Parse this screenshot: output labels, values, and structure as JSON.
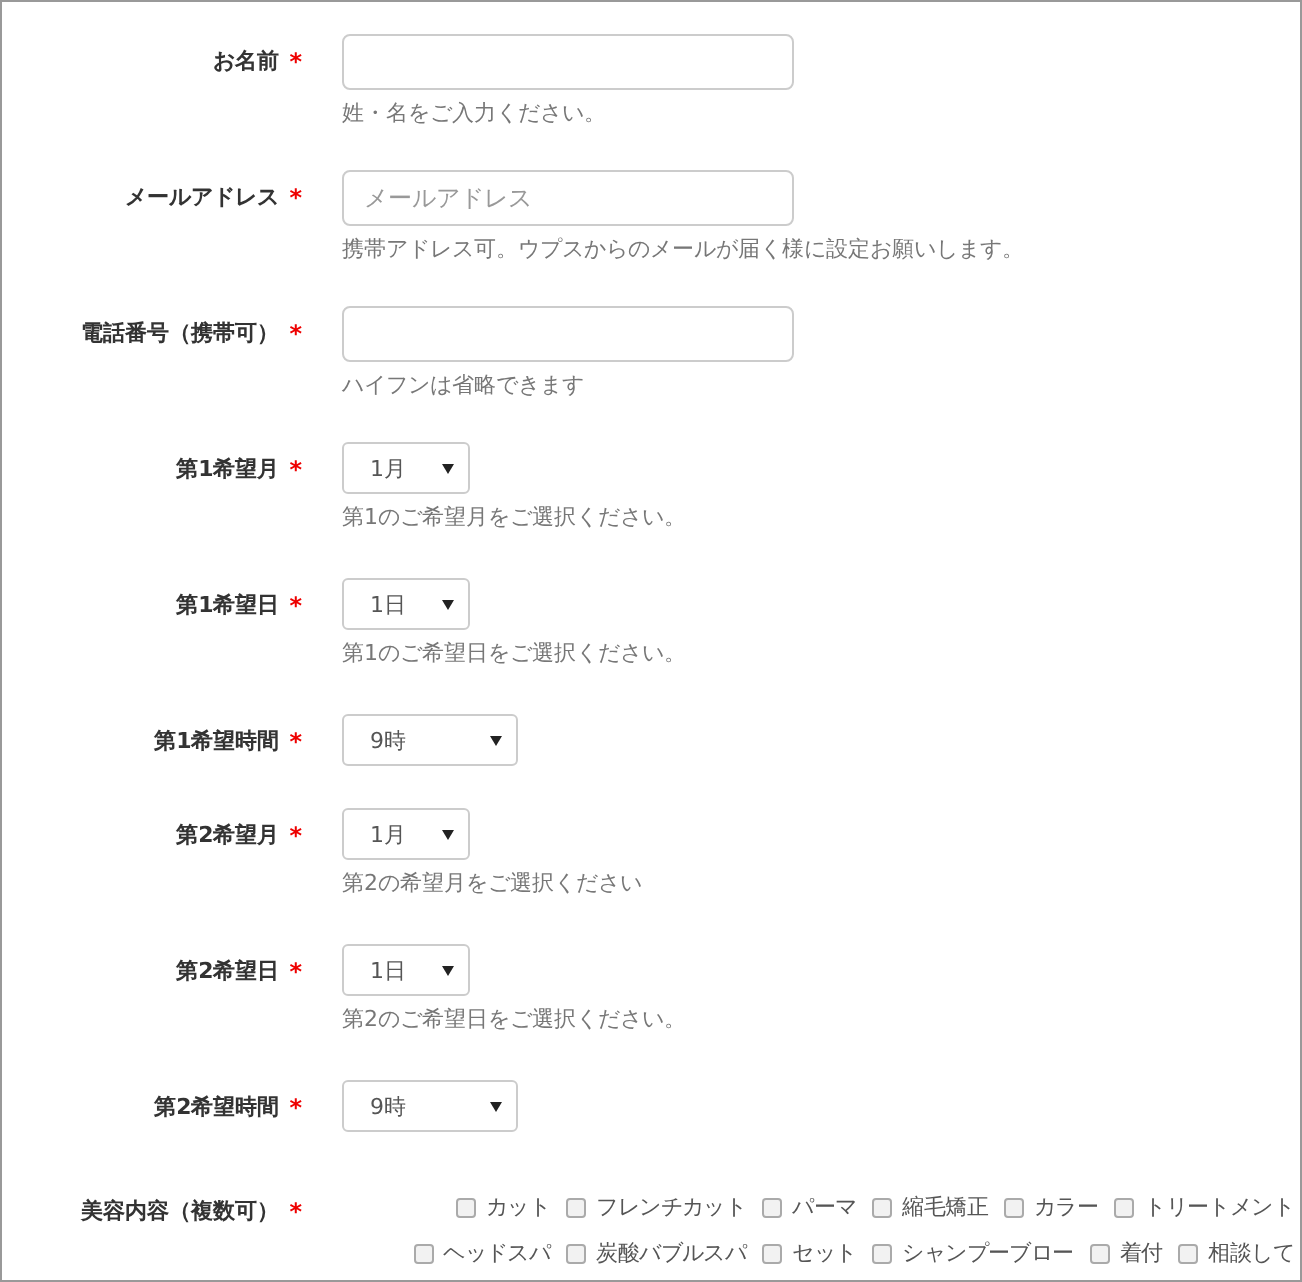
{
  "fields": [
    {
      "kind": "text",
      "label": "お名前",
      "mark": "*",
      "help": "姓・名をご入力ください。"
    },
    {
      "kind": "text",
      "label": "メールアドレス",
      "mark": "*",
      "placeholder": "メールアドレス",
      "help": "携帯アドレス可。ウプスからのメールが届く様に設定お願いします。"
    },
    {
      "kind": "text",
      "label": "電話番号（携帯可）",
      "mark": "*",
      "help": "ハイフンは省略できます"
    },
    {
      "kind": "select",
      "label": "第1希望月",
      "mark": "*",
      "value": "1月",
      "help": "第1のご希望月をご選択ください。"
    },
    {
      "kind": "select",
      "label": "第1希望日",
      "mark": "*",
      "value": "1日",
      "help": "第1のご希望日をご選択ください。"
    },
    {
      "kind": "wide-select",
      "label": "第1希望時間",
      "mark": "*",
      "value": "9時"
    },
    {
      "kind": "select",
      "label": "第2希望月",
      "mark": "*",
      "value": "1月",
      "help": "第2の希望月をご選択ください"
    },
    {
      "kind": "select",
      "label": "第2希望日",
      "mark": "*",
      "value": "1日",
      "help": "第2のご希望日をご選択ください。"
    },
    {
      "kind": "wide-select",
      "label": "第2希望時間",
      "mark": "*",
      "value": "9時"
    },
    {
      "kind": "checkboxes",
      "label": "美容内容（複数可）",
      "mark": "*",
      "options": [
        {
          "label": "カット",
          "checked": false
        },
        {
          "label": "フレンチカット",
          "checked": false
        },
        {
          "label": "パーマ",
          "checked": false
        },
        {
          "label": "縮毛矯正",
          "checked": false
        },
        {
          "label": "カラー",
          "checked": false
        },
        {
          "label": "トリートメント",
          "checked": false
        },
        {
          "label": "ヘッドスパ",
          "checked": false
        },
        {
          "label": "炭酸バブルスパ",
          "checked": false
        },
        {
          "label": "セット",
          "checked": false
        },
        {
          "label": "シャンプーブロー",
          "checked": false
        },
        {
          "label": "着付",
          "checked": false
        },
        {
          "label": "相談して",
          "checked": false
        }
      ]
    }
  ]
}
